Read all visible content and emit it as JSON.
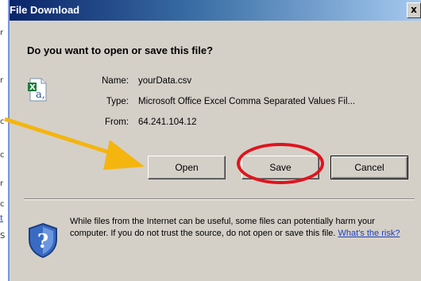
{
  "background": {
    "left_chars": [
      "r",
      "r",
      "c",
      "c",
      "r",
      "c",
      "t",
      "S"
    ]
  },
  "dialog": {
    "title": "File Download",
    "close_label": "x",
    "question": "Do you want to open or save this file?",
    "file_icon": "excel-csv-file-icon",
    "info": {
      "name_label": "Name:",
      "name_value": "yourData.csv",
      "type_label": "Type:",
      "type_value": "Microsoft Office Excel Comma Separated Values Fil...",
      "from_label": "From:",
      "from_value": "64.241.104.12"
    },
    "buttons": {
      "open": "Open",
      "save": "Save",
      "cancel": "Cancel"
    },
    "warning": {
      "text": "While files from the Internet can be useful, some files can potentially harm your computer. If you do not trust the source, do not open or save this file.",
      "link": "What's the risk?"
    }
  },
  "annotations": {
    "arrow_color": "#f5b50f",
    "ellipse_color": "#e0141e"
  },
  "colors": {
    "dialog_bg": "#d4d0c8",
    "titlebar_start": "#0a246a",
    "titlebar_end": "#a6caf0"
  }
}
